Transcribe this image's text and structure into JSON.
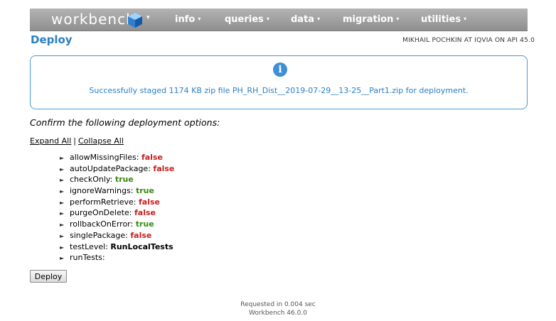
{
  "navbar": {
    "brand": "workbench",
    "menus": [
      {
        "label": "info"
      },
      {
        "label": "queries"
      },
      {
        "label": "data"
      },
      {
        "label": "migration"
      },
      {
        "label": "utilities"
      }
    ]
  },
  "header": {
    "title": "Deploy",
    "user_info": "MIKHAIL POCHKIN AT IQVIA ON API 45.0"
  },
  "message": {
    "icon": "info-icon",
    "text": "Successfully staged 1174 KB zip file PH_RH_Dist__2019-07-29__13-25__Part1.zip for deployment."
  },
  "confirm_text": "Confirm the following deployment options:",
  "links": {
    "expand_all": "Expand All",
    "separator": "|",
    "collapse_all": "Collapse All"
  },
  "options": [
    {
      "name": "allowMissingFiles:",
      "value": "false",
      "kind": "false"
    },
    {
      "name": "autoUpdatePackage:",
      "value": "false",
      "kind": "false"
    },
    {
      "name": "checkOnly:",
      "value": "true",
      "kind": "true"
    },
    {
      "name": "ignoreWarnings:",
      "value": "true",
      "kind": "true"
    },
    {
      "name": "performRetrieve:",
      "value": "false",
      "kind": "false"
    },
    {
      "name": "purgeOnDelete:",
      "value": "false",
      "kind": "false"
    },
    {
      "name": "rollbackOnError:",
      "value": "true",
      "kind": "true"
    },
    {
      "name": "singlePackage:",
      "value": "false",
      "kind": "false"
    },
    {
      "name": "testLevel:",
      "value": "RunLocalTests",
      "kind": "neutral"
    },
    {
      "name": "runTests:",
      "value": "",
      "kind": "neutral"
    }
  ],
  "deploy_button": "Deploy",
  "footer": {
    "timing": "Requested in 0.004 sec",
    "version": "Workbench 46.0.0"
  },
  "colors": {
    "title_blue": "#2a7fc2",
    "false_red": "#c81e1e",
    "true_green": "#3a8a0f"
  }
}
